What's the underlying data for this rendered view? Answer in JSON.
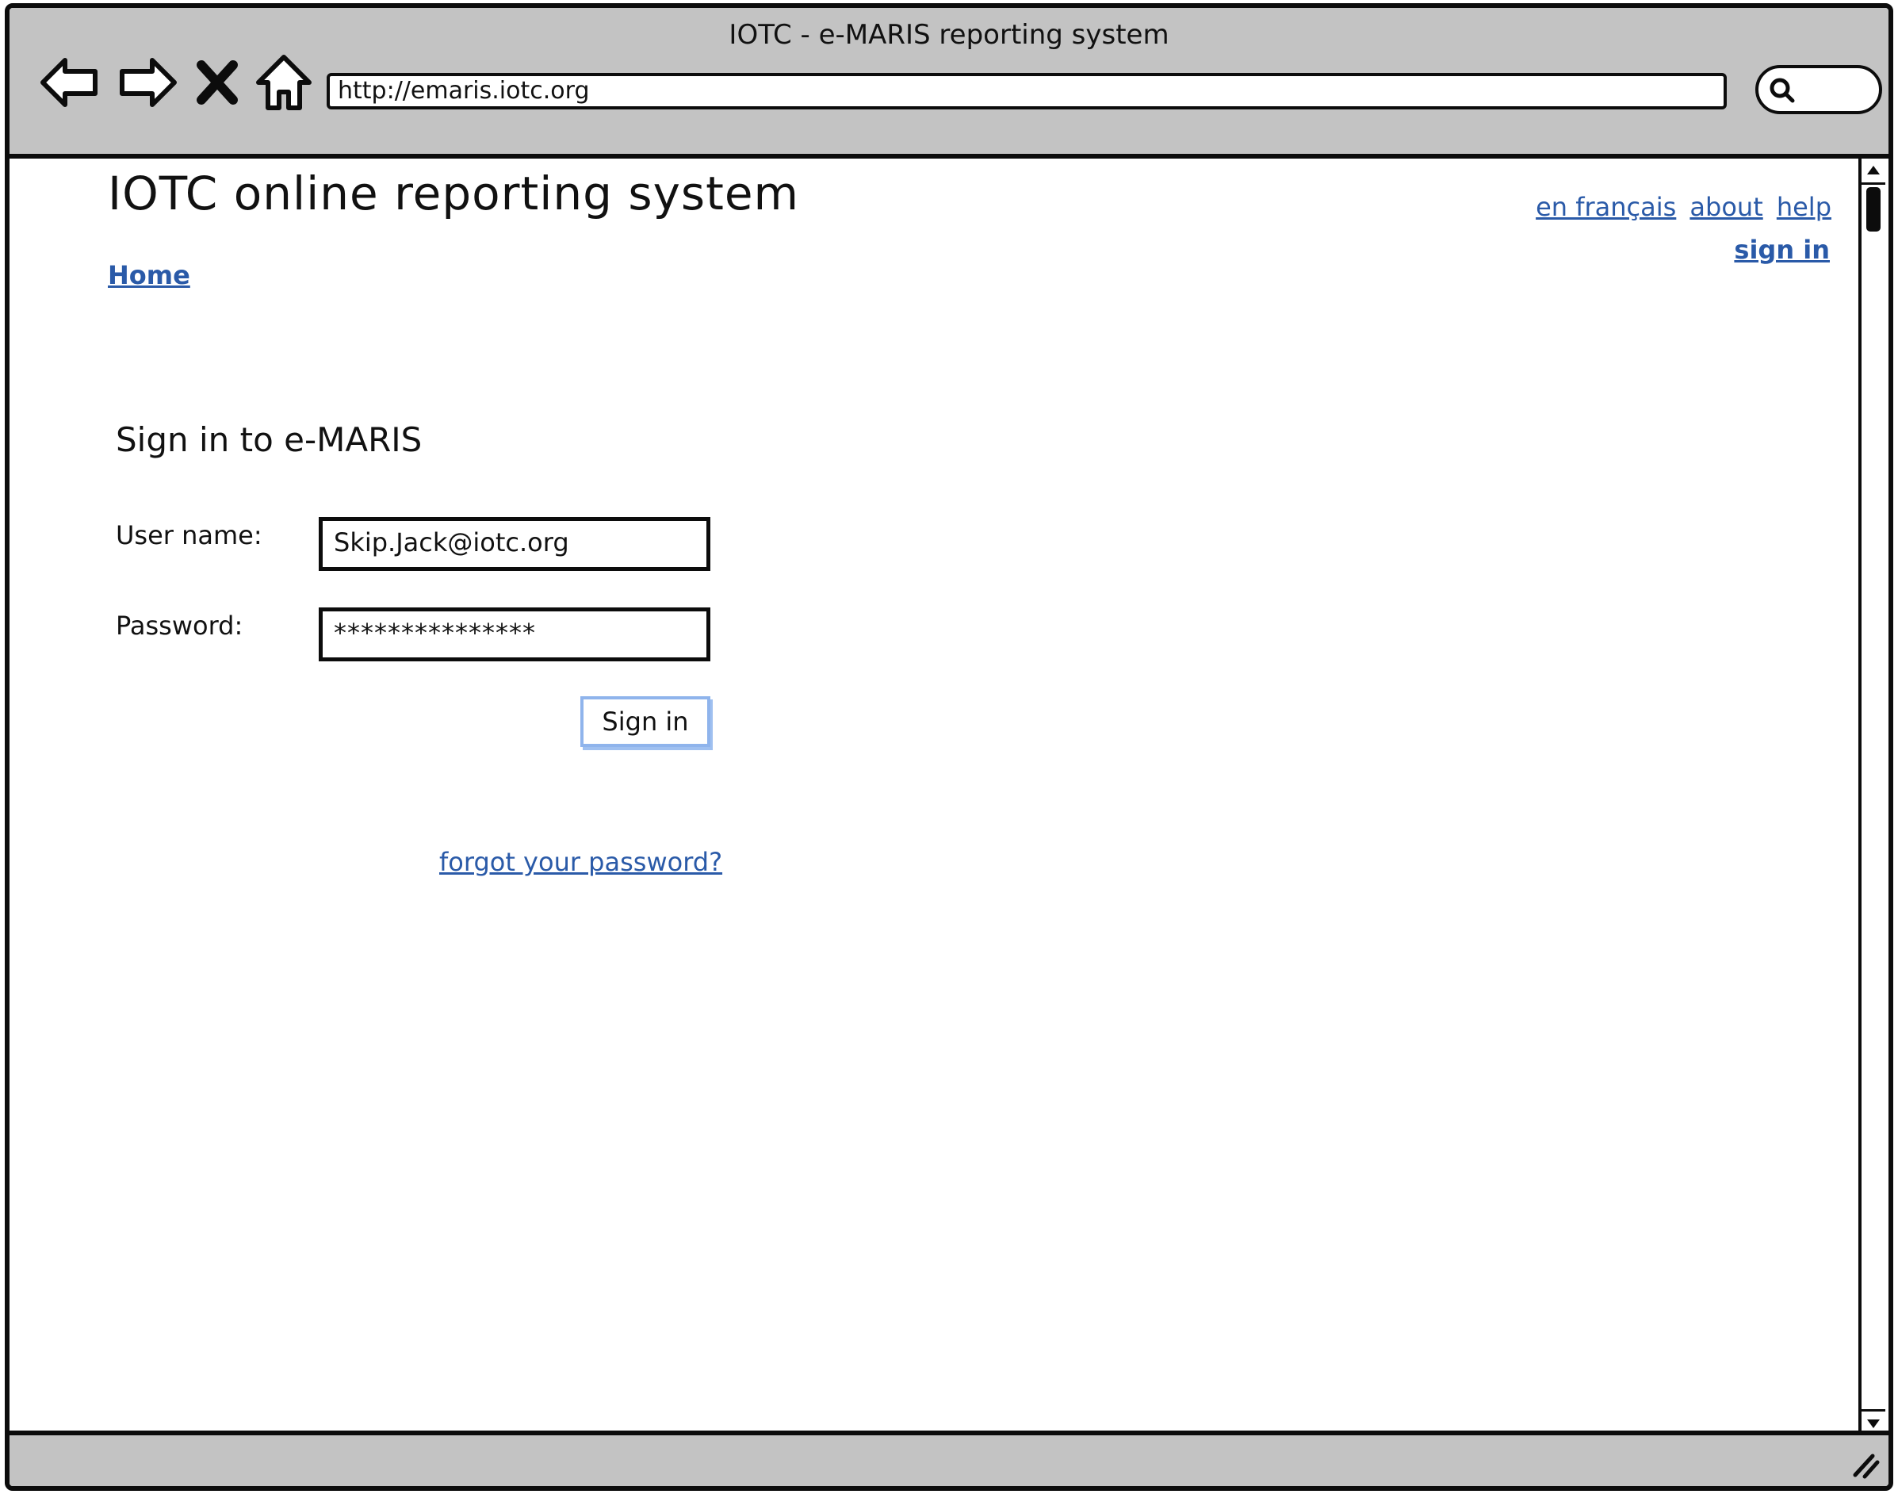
{
  "window": {
    "title": "IOTC - e-MARIS reporting system"
  },
  "browser": {
    "url": "http://emaris.iotc.org",
    "nav_icons": [
      "back-arrow-icon",
      "forward-arrow-icon",
      "close-x-icon",
      "home-icon"
    ],
    "search_icon": "magnifier-icon"
  },
  "header": {
    "site_title": "IOTC online reporting system",
    "links": {
      "french": "en français",
      "about": "about",
      "help": "help",
      "sign_in": "sign in"
    },
    "breadcrumb_home": "Home"
  },
  "form": {
    "title": "Sign in to e-MARIS",
    "username_label": "User name:",
    "username_value": "Skip.Jack@iotc.org",
    "password_label": "Password:",
    "password_value": "***************",
    "submit_label": "Sign in",
    "forgot_link": "forgot your password?"
  },
  "colors": {
    "link": "#2a5aa8",
    "chrome": "#c3c3c3",
    "button_border": "#8fb4ec"
  }
}
